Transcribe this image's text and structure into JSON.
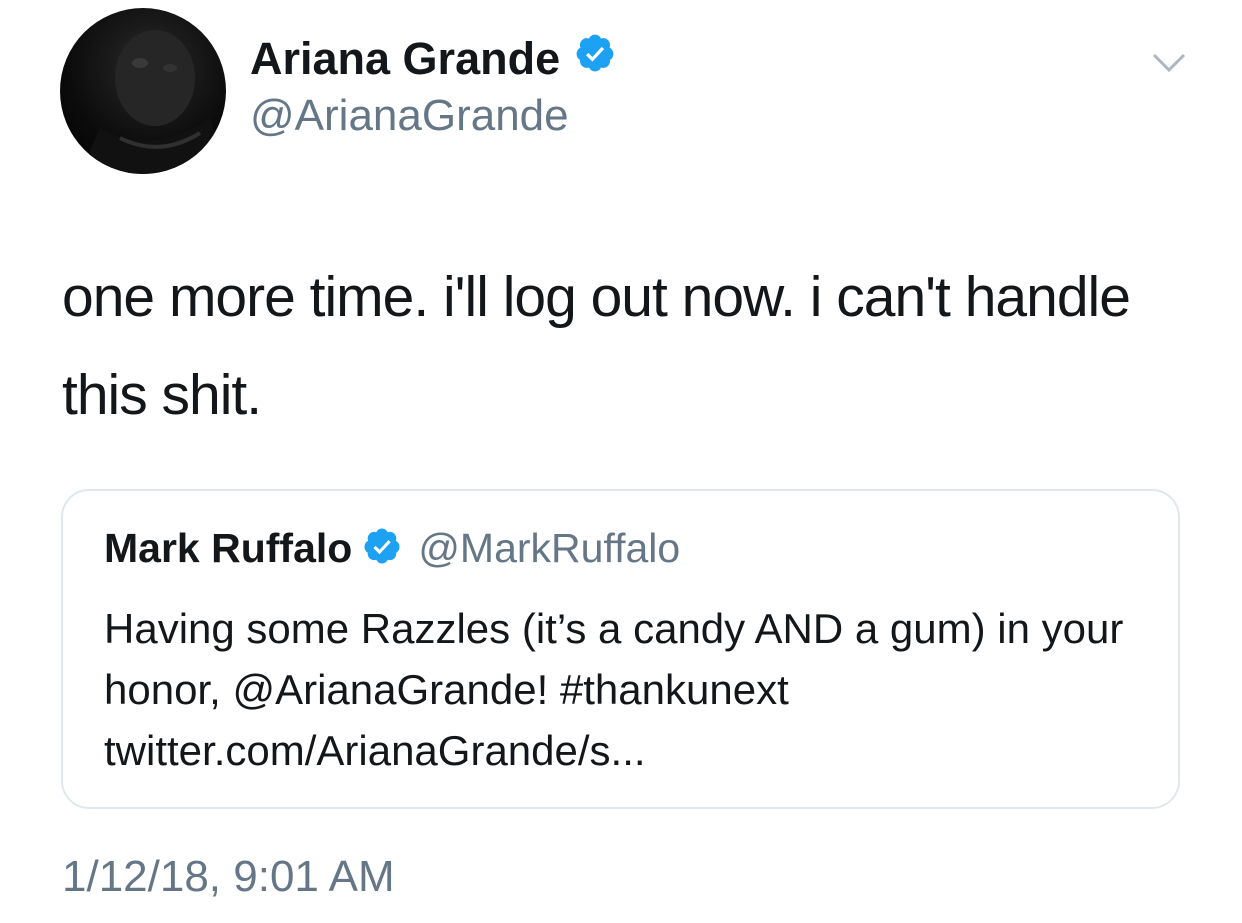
{
  "tweet": {
    "author": {
      "display_name": "Ariana Grande",
      "handle": "@ArianaGrande",
      "verified": true,
      "avatar_icon": "profile-photo"
    },
    "text": "one more time. i'll log out now. i can't handle this shit.",
    "timestamp": "1/12/18, 9:01 AM",
    "menu_icon": "chevron-down-icon"
  },
  "quoted_tweet": {
    "author": {
      "display_name": "Mark Ruffalo",
      "handle": "@MarkRuffalo",
      "verified": true
    },
    "text": "Having some Razzles (it’s a candy AND a gum) in your honor, @ArianaGrande! #thankunext twitter.com/ArianaGrande/s..."
  },
  "colors": {
    "primary_text": "#14171a",
    "secondary_text": "#657786",
    "verified_blue": "#1da1f2",
    "card_border": "#e1e8ed"
  }
}
